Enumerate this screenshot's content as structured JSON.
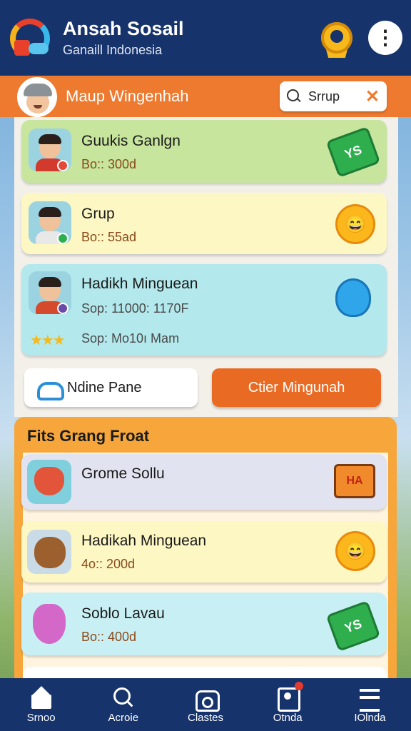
{
  "header": {
    "title": "Ansah Sosail",
    "subtitle": "Ganaill Indonesia",
    "logo_icon": "rainbow-logo-icon",
    "badge_icon": "gear-badge-icon",
    "more_icon": "more-vertical-icon"
  },
  "profile_bar": {
    "name": "Maup Wingenhah",
    "search": {
      "value": "Srrup",
      "icon": "search-icon",
      "clear_icon": "close-icon"
    },
    "accent_color": "#ee7a2f"
  },
  "cards": [
    {
      "name": "Guukis Ganlgn",
      "meta": "Bo:: 300d",
      "reward_text": "YS",
      "reward_icon": "gem-icon",
      "color": "#c7e59d"
    },
    {
      "name": "Grup",
      "meta": "Bo:: 55ad",
      "reward_text": "",
      "reward_icon": "sun-icon",
      "color": "#fdf7c4"
    },
    {
      "name": "Hadikh Minguean",
      "meta": "Sop: 11000: 1170F",
      "extra": "Sop: Mo10ı Mam",
      "stars": "★★★",
      "reward_icon": "potion-icon",
      "color": "#b3e8ec"
    }
  ],
  "buttons": {
    "online": "Ndine Pane",
    "other": "Ctier Mingunah"
  },
  "section": {
    "title": "Fits Grang Froat",
    "items": [
      {
        "name": "Grome Sollu",
        "meta": "",
        "reward_text": "HA",
        "reward_icon": "sign-icon",
        "thumb": "fox"
      },
      {
        "name": "Hadikah Minguean",
        "meta": "4o:: 200d",
        "reward_text": "",
        "reward_icon": "sun-icon",
        "thumb": "dog"
      },
      {
        "name": "Soblo Lavau",
        "meta": "Bo:: 400d",
        "reward_text": "YS",
        "reward_icon": "gem-icon",
        "thumb": "medal"
      }
    ]
  },
  "bottom_nav": [
    {
      "label": "Srnoo",
      "icon": "home-icon"
    },
    {
      "label": "Acroie",
      "icon": "search-icon"
    },
    {
      "label": "Clastes",
      "icon": "camera-icon"
    },
    {
      "label": "Otnda",
      "icon": "profile-icon"
    },
    {
      "label": "IOlnda",
      "icon": "list-icon"
    }
  ],
  "colors": {
    "header_bg": "#17336b",
    "orange": "#e96b23",
    "section_bg": "#f6a63a"
  }
}
